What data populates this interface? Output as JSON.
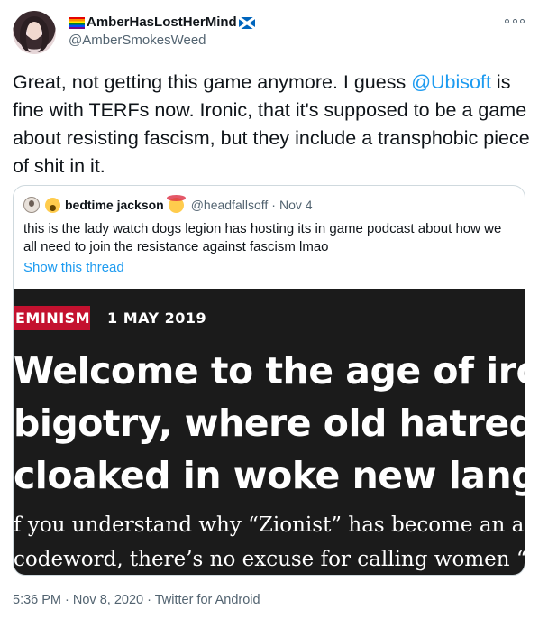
{
  "author": {
    "display_name": "AmberHasLostHerMind",
    "handle": "@AmberSmokesWeed",
    "flags": [
      "rainbow-flag-icon",
      "scotland-flag-icon"
    ]
  },
  "tweet": {
    "text_before_mention": "Great, not getting this game anymore. I guess ",
    "mention": "@Ubisoft",
    "text_after_mention": " is fine with TERFs now. Ironic, that it's supposed to be a game about resisting fascism, but they include a transphobic piece of shit in it.",
    "timestamp": "5:36 PM · Nov 8, 2020 · Twitter for Android"
  },
  "quoted_tweet": {
    "name": "bedtime jackson",
    "handle": "@headfallsoff",
    "date": "Nov 4",
    "separator": "·",
    "text": "this is the lady watch dogs legion has hosting its in game podcast about how we all need to join the resistance against fascism lmao",
    "show_thread": "Show this thread",
    "image": {
      "tag": "EMINISM",
      "date": "1 MAY 2019",
      "headline_lines": [
        "Welcome to the age of ironic",
        "bigotry, where old hatreds ar",
        "cloaked in woke new languag"
      ],
      "standfirst_lines": [
        "f you understand why “Zionist” has become an a",
        "codeword, there’s no excuse for calling women “"
      ]
    }
  },
  "colors": {
    "link": "#1d9bf0",
    "secondary_text": "#536471",
    "tag_red": "#c4112f",
    "image_bg": "#1b1b1b"
  }
}
